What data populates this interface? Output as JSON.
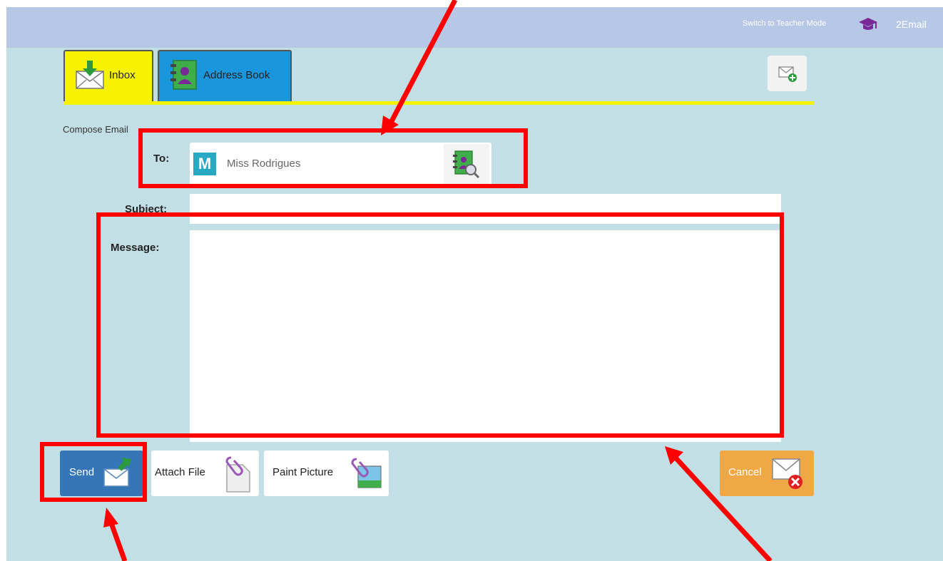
{
  "header": {
    "teacher_mode_link": "Switch to Teacher Mode",
    "app_name": "2Email",
    "icons": {
      "teacher_mode": "graduation-cap-icon"
    }
  },
  "tabs": [
    {
      "label": "Inbox",
      "icon": "inbox-icon",
      "color": "#f6f200",
      "active": true
    },
    {
      "label": "Address Book",
      "icon": "address-book-icon",
      "color": "#1996dc"
    }
  ],
  "toolbar": {
    "new_email_icon": "new-email-icon"
  },
  "compose": {
    "title": "Compose Email",
    "to_label": "To:",
    "recipient": {
      "initial": "M",
      "name": "Miss Rodrigues"
    },
    "subject_label": "Subject:",
    "subject_value": "",
    "message_label": "Message:",
    "message_value": ""
  },
  "actions": {
    "send": "Send",
    "attach_file": "Attach File",
    "paint_picture": "Paint Picture",
    "cancel": "Cancel"
  },
  "colors": {
    "background": "#c2dfe6",
    "topbar": "#b6c8e6",
    "send": "#3476b7",
    "cancel": "#f0a746",
    "highlight": "#ff0000"
  }
}
